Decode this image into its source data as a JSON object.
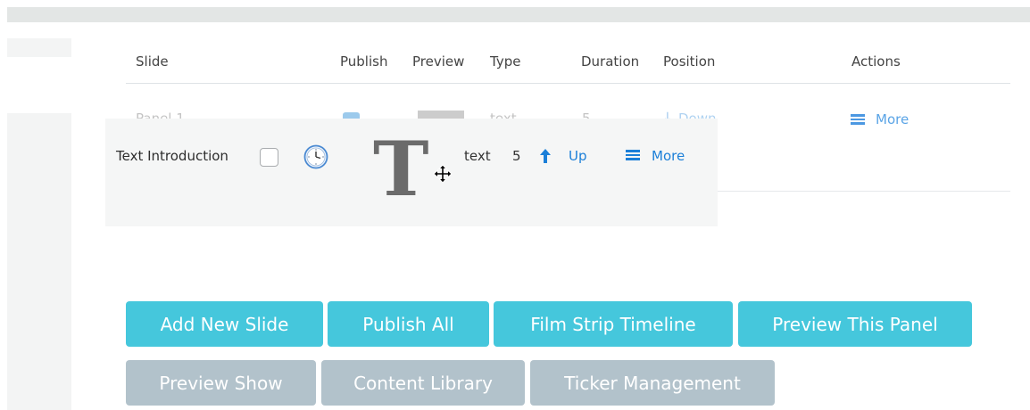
{
  "table": {
    "headers": {
      "slide": "Slide",
      "publish": "Publish",
      "preview": "Preview",
      "type": "Type",
      "duration": "Duration",
      "position": "Position",
      "actions": "Actions"
    },
    "rows": [
      {
        "title": "Panel 1",
        "type": "text",
        "duration": "5",
        "position_label": "Down",
        "actions_label": "More",
        "position_icon": "arrow-down-icon",
        "actions_icon": "hamburger-icon"
      }
    ]
  },
  "dragging_row": {
    "title": "Text Introduction",
    "published": false,
    "schedule_icon": "clock-icon",
    "preview_glyph": "T",
    "type": "text",
    "duration": "5",
    "position_label": "Up",
    "position_icon": "arrow-up-icon",
    "actions_label": "More",
    "actions_icon": "hamburger-icon",
    "cursor": "move-cursor-icon"
  },
  "buttons": {
    "primary": [
      {
        "label": "Add New Slide"
      },
      {
        "label": "Publish All"
      },
      {
        "label": "Film Strip Timeline"
      },
      {
        "label": "Preview This Panel"
      }
    ],
    "secondary": [
      {
        "label": "Preview Show"
      },
      {
        "label": "Content Library"
      },
      {
        "label": "Ticker Management"
      }
    ]
  },
  "colors": {
    "primary_button": "#45c7dc",
    "secondary_button": "#b2c2cb",
    "link": "#1b7fd8",
    "link_faded": "#5aa4e6",
    "drag_panel_bg": "#f5f6f6"
  }
}
